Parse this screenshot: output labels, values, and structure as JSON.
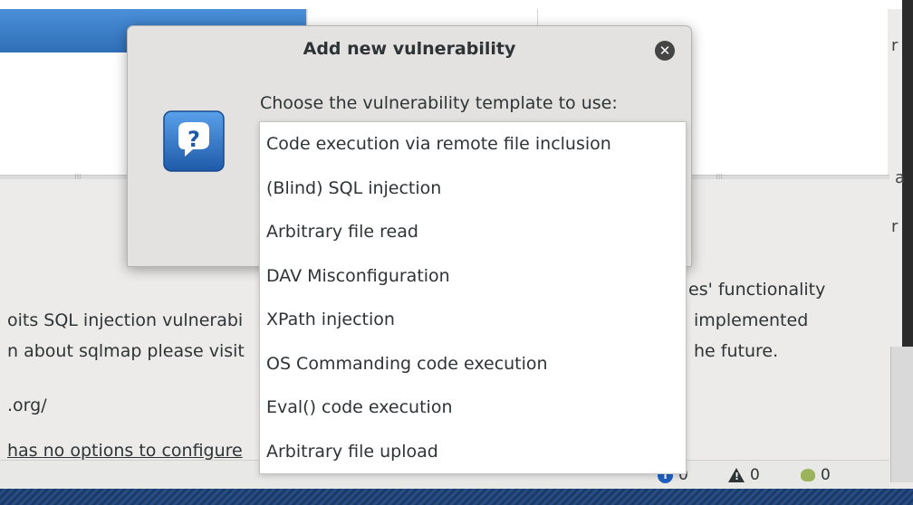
{
  "dialog": {
    "title": "Add new vulnerability",
    "prompt": "Choose the vulnerability template to use:",
    "close_icon": "close-icon",
    "question_icon": "question-icon"
  },
  "templates": [
    "Code execution via remote file inclusion",
    "(Blind) SQL injection",
    "Arbitrary file read",
    "DAV Misconfiguration",
    "XPath injection",
    "OS Commanding code execution",
    "Eval() code execution",
    "Arbitrary file upload"
  ],
  "background": {
    "left_lines": [
      "oits SQL injection vulnerabi",
      "n about sqlmap please visit",
      ".org/",
      "has no options to configure"
    ],
    "right_lines": [
      "es' functionality",
      "implemented",
      "he future."
    ],
    "right_edge_chars": [
      "r",
      "a",
      "r"
    ]
  },
  "statusbar": {
    "info_count": "0",
    "warning_count": "0",
    "vuln_count": "0"
  },
  "colors": {
    "accent_blue": "#2f6fb7",
    "dialog_bg": "#e3e2e0",
    "close_btn": "#454545"
  }
}
